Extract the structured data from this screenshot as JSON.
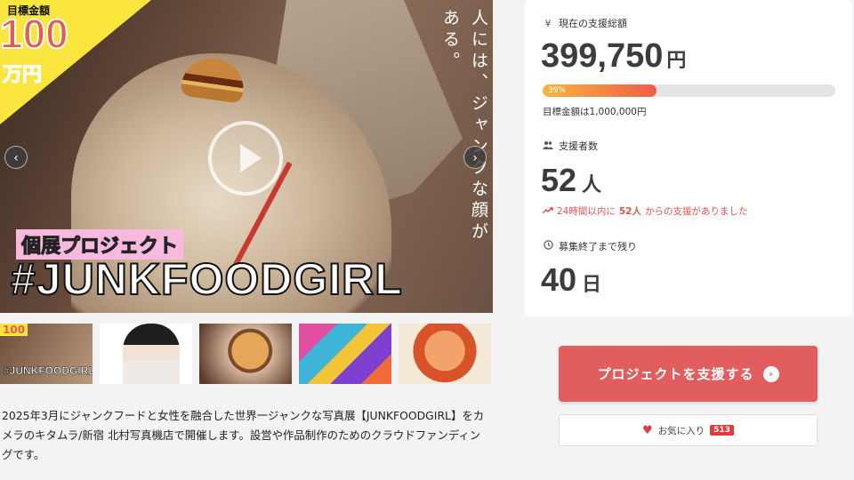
{
  "hero": {
    "corner_label": "目標金額",
    "corner_amount": "100",
    "corner_unit": "万円",
    "vertical_text": "人には、ジャンクな顔がある。",
    "tag": "個展プロジェクト",
    "title": "#JUNKFOODGIRL",
    "prev_arrow": "‹",
    "next_arrow": "›"
  },
  "thumbnails": [
    {
      "mini_num": "100",
      "mini_title": "#JUNKFOODGIRL"
    },
    {},
    {},
    {},
    {}
  ],
  "description": "2025年3月にジャンクフードと女性を融合した世界一ジャンクな写真展【JUNKFOODGIRL】をカメラのキタムラ/新宿 北村写真機店で開催します。設営や作品制作のためのクラウドファンディングです。",
  "stats": {
    "total_label": "現在の支援総額",
    "total_icon": "¥",
    "total_amount": "399,750",
    "total_unit": "円",
    "progress_percent": 39,
    "progress_text": "39%",
    "target_text": "目標金額は1,000,000円",
    "backers_label": "支援者数",
    "backers_count": "52",
    "backers_unit": "人",
    "recent_prefix": "24時間以内に",
    "recent_count": "52人",
    "recent_suffix": "からの支援がありました",
    "remaining_label": "募集終了まで残り",
    "remaining_days": "40",
    "remaining_unit": "日"
  },
  "actions": {
    "support_label": "プロジェクトを支援する",
    "favorite_label": "お気に入り",
    "favorite_count": "513"
  },
  "colors": {
    "accent": "#e25e5e",
    "progress_start": "#f7b63e",
    "progress_end": "#f35b47",
    "corner_yellow": "#fbe53f"
  }
}
